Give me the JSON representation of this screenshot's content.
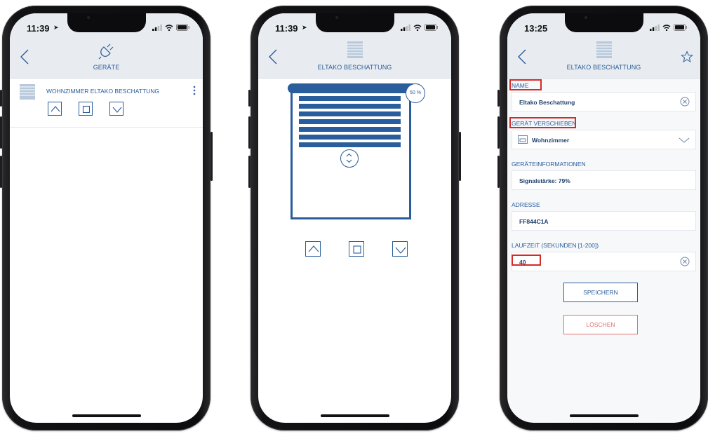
{
  "phone1": {
    "time": "11:39",
    "title": "GERÄTE",
    "device_name": "WOHNZIMMER ELTAKO BESCHATTUNG",
    "icons": [
      "back-icon",
      "plug-icon",
      "blind-icon",
      "more-icon",
      "up-arrow-icon",
      "stop-icon",
      "down-arrow-icon"
    ]
  },
  "phone2": {
    "time": "11:39",
    "title": "ELTAKO BESCHATTUNG",
    "position_label": "50 %",
    "position_percent": 50,
    "icons": [
      "back-icon",
      "blind-icon",
      "drag-handle-icon",
      "up-arrow-icon",
      "stop-icon",
      "down-arrow-icon"
    ]
  },
  "phone3": {
    "time": "13:25",
    "title": "ELTAKO BESCHATTUNG",
    "name_label": "NAME",
    "name_value": "Eltako Beschattung",
    "move_label": "GERÄT VERSCHIEBEN",
    "room_value": "Wohnzimmer",
    "info_label": "GERÄTEINFORMATIONEN",
    "signal_value": "Signalstärke: 79%",
    "address_label": "ADRESSE",
    "address_value": "FF844C1A",
    "runtime_label": "LAUFZEIT (SEKUNDEN [1-200])",
    "runtime_value": "40",
    "save_label": "SPEICHERN",
    "delete_label": "LÖSCHEN",
    "icons": [
      "back-icon",
      "blind-icon",
      "star-icon",
      "clear-icon",
      "room-icon",
      "chevron-down-icon"
    ]
  },
  "colors": {
    "accent": "#2a5d9c",
    "highlight": "#d42a2a",
    "delete": "#e07070",
    "header": "#e8ecf0"
  }
}
